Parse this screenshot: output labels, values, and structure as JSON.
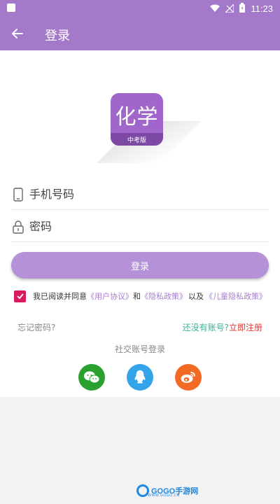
{
  "status_bar": {
    "time": "11:23"
  },
  "toolbar": {
    "title": "登录"
  },
  "logo": {
    "text": "化学",
    "subtitle": "中考版"
  },
  "form": {
    "phone_placeholder": "手机号码",
    "password_placeholder": "密码",
    "login_button": "登录"
  },
  "agreement": {
    "checked": true,
    "prefix": "我已阅读并同意",
    "user_agreement": "《用户协议》",
    "and": "和",
    "privacy_policy": "《隐私政策》",
    "also": "以及",
    "child_privacy": "《儿童隐私政策》"
  },
  "links": {
    "forgot_password": "忘记密码?",
    "no_account": "还没有账号?",
    "register_now": "立即注册"
  },
  "social": {
    "title": "社交账号登录",
    "buttons": [
      {
        "name": "wechat",
        "color": "#2aa12e"
      },
      {
        "name": "qq",
        "color": "#34a4ea"
      },
      {
        "name": "weibo",
        "color": "#f26a23"
      }
    ]
  },
  "watermark": {
    "text": "GOGO手游网",
    "sub": "WWW.GOGO.CN"
  },
  "colors": {
    "primary": "#a579c9",
    "button": "#b591d8",
    "accent_red": "#e53935",
    "accent_green": "#35b39a",
    "checkbox": "#d81b60"
  }
}
